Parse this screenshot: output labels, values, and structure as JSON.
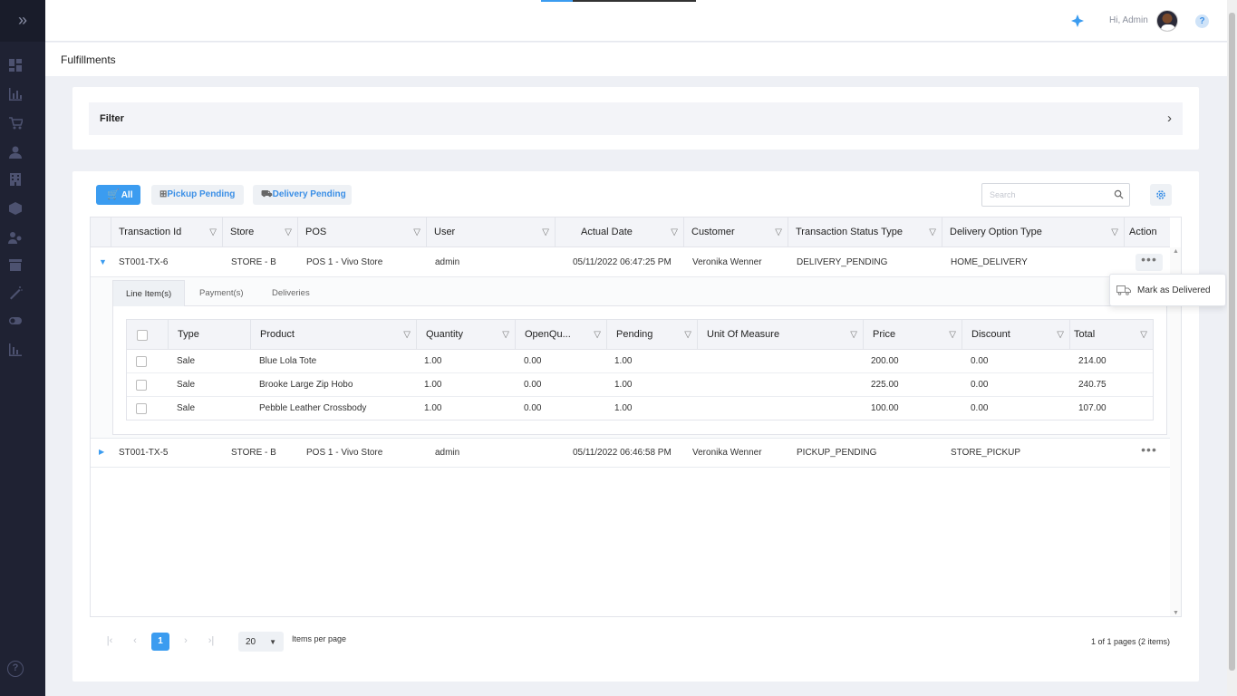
{
  "topbar": {
    "greeting": "Hi, Admin",
    "help": "?"
  },
  "sidebar": {
    "expand": "»",
    "items": [
      {
        "icon": "dashboard-icon"
      },
      {
        "icon": "chart-icon"
      },
      {
        "icon": "cart-icon"
      },
      {
        "icon": "user-icon"
      },
      {
        "icon": "building-icon"
      },
      {
        "icon": "box-icon"
      },
      {
        "icon": "people-icon"
      },
      {
        "icon": "store-icon"
      },
      {
        "icon": "magic-icon"
      },
      {
        "icon": "toggle-icon"
      },
      {
        "icon": "report-icon"
      }
    ],
    "help": "?"
  },
  "page": {
    "title": "Fulfillments"
  },
  "filter": {
    "label": "Filter"
  },
  "toolbar": {
    "all": "All",
    "pickup": "Pickup Pending",
    "delivery": "Delivery Pending",
    "search_placeholder": "Search"
  },
  "grid": {
    "columns": [
      "Transaction Id",
      "Store",
      "POS",
      "User",
      "Actual Date",
      "Customer",
      "Transaction Status Type",
      "Delivery Option Type",
      "Action"
    ],
    "rows": [
      {
        "transaction_id": "ST001-TX-6",
        "store": "STORE - B",
        "pos": "POS 1 - Vivo Store",
        "user": "admin",
        "date": "05/11/2022 06:47:25 PM",
        "customer": "Veronika Wenner",
        "status": "DELIVERY_PENDING",
        "delivery": "HOME_DELIVERY"
      },
      {
        "transaction_id": "ST001-TX-5",
        "store": "STORE - B",
        "pos": "POS 1 - Vivo Store",
        "user": "admin",
        "date": "05/11/2022 06:46:58 PM",
        "customer": "Veronika Wenner",
        "status": "PICKUP_PENDING",
        "delivery": "STORE_PICKUP"
      }
    ]
  },
  "detail": {
    "tabs": [
      "Line Item(s)",
      "Payment(s)",
      "Deliveries"
    ],
    "columns": [
      "Type",
      "Product",
      "Quantity",
      "OpenQu...",
      "Pending",
      "Unit Of Measure",
      "Price",
      "Discount",
      "Total"
    ],
    "items": [
      {
        "type": "Sale",
        "product": "Blue Lola Tote",
        "quantity": "1.00",
        "open": "0.00",
        "pending": "1.00",
        "uom": "",
        "price": "200.00",
        "discount": "0.00",
        "total": "214.00"
      },
      {
        "type": "Sale",
        "product": "Brooke Large Zip Hobo",
        "quantity": "1.00",
        "open": "0.00",
        "pending": "1.00",
        "uom": "",
        "price": "225.00",
        "discount": "0.00",
        "total": "240.75"
      },
      {
        "type": "Sale",
        "product": "Pebble Leather Crossbody",
        "quantity": "1.00",
        "open": "0.00",
        "pending": "1.00",
        "uom": "",
        "price": "100.00",
        "discount": "0.00",
        "total": "107.00"
      }
    ]
  },
  "pager": {
    "first": "|‹",
    "prev": "‹",
    "current": "1",
    "next": "›",
    "last": "›|",
    "page_size": "20",
    "items_per_page": "Items per page",
    "info": "1 of 1 pages (2 items)"
  },
  "popup": {
    "mark_delivered": "Mark as Delivered"
  },
  "colors": {
    "accent": "#3b9cf0",
    "sidebar": "#1f2233"
  }
}
